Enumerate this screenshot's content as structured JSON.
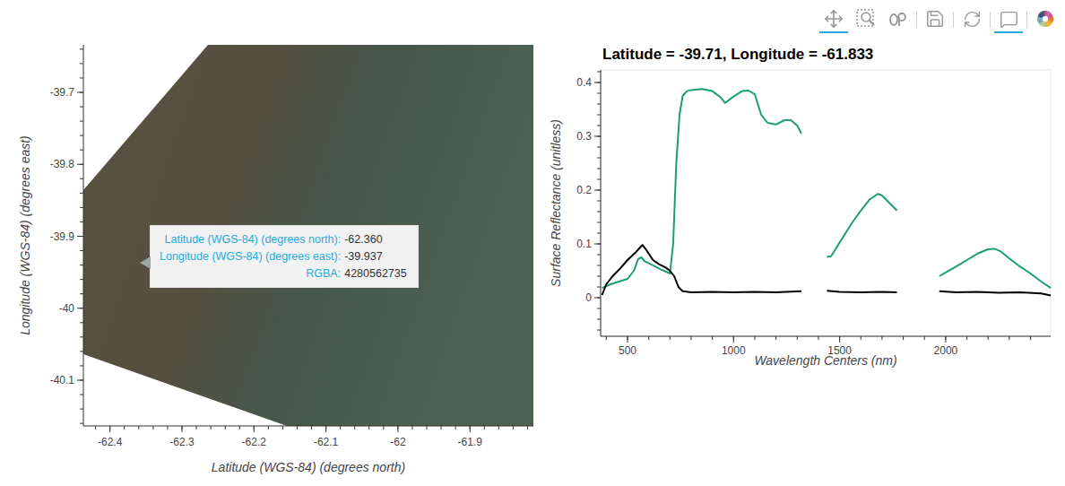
{
  "toolbar": {
    "tools": [
      {
        "kind": "pan",
        "active": true,
        "group": 1
      },
      {
        "kind": "box-zoom",
        "active": false,
        "group": 1
      },
      {
        "kind": "wheel-zoom",
        "active": false,
        "group": 1
      },
      {
        "kind": "save",
        "active": false,
        "group": 2
      },
      {
        "kind": "reset",
        "active": false,
        "group": 3
      },
      {
        "kind": "hover",
        "active": true,
        "group": 4
      },
      {
        "kind": "logo",
        "active": false,
        "group": 5
      }
    ]
  },
  "map": {
    "x_axis": {
      "label": "Latitude (WGS-84) (degrees north)",
      "ticks": [
        "-62.4",
        "-62.3",
        "-62.2",
        "-62.1",
        "-62",
        "-61.9"
      ]
    },
    "y_axis": {
      "label": "Longitude (WGS-84) (degrees east)",
      "ticks": [
        "-39.7",
        "-39.8",
        "-39.9",
        "-40",
        "-40.1"
      ]
    },
    "tooltip": {
      "rows": [
        {
          "label": "Latitude (WGS-84) (degrees north):",
          "value": "-62.360"
        },
        {
          "label": "Longitude (WGS-84) (degrees east):",
          "value": "-39.937"
        },
        {
          "label": "RGBA:",
          "value": "4280562735"
        }
      ]
    }
  },
  "spectrum": {
    "title": "Latitude = -39.71, Longitude = -61.833",
    "x_axis": {
      "label": "Wavelength Centers (nm)",
      "ticks": [
        "500",
        "1000",
        "1500",
        "2000"
      ]
    },
    "y_axis": {
      "label": "Surface Reflectance (unitless)",
      "ticks": [
        "0",
        "0.1",
        "0.2",
        "0.3",
        "0.4"
      ]
    },
    "series": [
      {
        "color": "#1b9e77",
        "segments": [
          {
            "wavelengths": [
              380,
              420,
              460,
              500,
              530,
              550,
              565,
              580,
              600,
              630,
              660,
              700,
              715,
              730,
              745,
              760,
              780,
              800,
              850,
              900,
              940,
              960,
              1000,
              1040,
              1070,
              1100,
              1130,
              1160,
              1200,
              1240,
              1270,
              1300,
              1320
            ],
            "values": [
              0.018,
              0.025,
              0.03,
              0.035,
              0.05,
              0.072,
              0.075,
              0.068,
              0.064,
              0.058,
              0.052,
              0.045,
              0.1,
              0.25,
              0.34,
              0.375,
              0.384,
              0.386,
              0.388,
              0.384,
              0.372,
              0.362,
              0.374,
              0.384,
              0.385,
              0.378,
              0.34,
              0.325,
              0.322,
              0.33,
              0.33,
              0.32,
              0.305
            ]
          },
          {
            "wavelengths": [
              1440,
              1460,
              1480,
              1520,
              1560,
              1600,
              1640,
              1680,
              1700,
              1730,
              1770
            ],
            "values": [
              0.076,
              0.077,
              0.09,
              0.115,
              0.14,
              0.162,
              0.182,
              0.193,
              0.19,
              0.178,
              0.162
            ]
          },
          {
            "wavelengths": [
              1970,
              2000,
              2050,
              2100,
              2150,
              2200,
              2230,
              2260,
              2300,
              2350,
              2400,
              2450,
              2495
            ],
            "values": [
              0.04,
              0.047,
              0.058,
              0.07,
              0.082,
              0.09,
              0.091,
              0.086,
              0.073,
              0.058,
              0.045,
              0.03,
              0.018
            ]
          }
        ]
      },
      {
        "color": "#000000",
        "segments": [
          {
            "wavelengths": [
              380,
              400,
              430,
              460,
              500,
              540,
              570,
              590,
              620,
              650,
              680,
              700,
              720,
              740,
              760,
              800,
              900,
              1000,
              1100,
              1200,
              1320
            ],
            "values": [
              0.005,
              0.025,
              0.04,
              0.052,
              0.07,
              0.085,
              0.098,
              0.088,
              0.07,
              0.062,
              0.056,
              0.05,
              0.04,
              0.02,
              0.012,
              0.01,
              0.011,
              0.01,
              0.011,
              0.01,
              0.012
            ]
          },
          {
            "wavelengths": [
              1440,
              1500,
              1600,
              1700,
              1770
            ],
            "values": [
              0.013,
              0.011,
              0.01,
              0.011,
              0.01
            ]
          },
          {
            "wavelengths": [
              1970,
              2050,
              2150,
              2250,
              2350,
              2450,
              2495
            ],
            "values": [
              0.012,
              0.01,
              0.011,
              0.009,
              0.01,
              0.008,
              0.004
            ]
          }
        ]
      }
    ]
  }
}
